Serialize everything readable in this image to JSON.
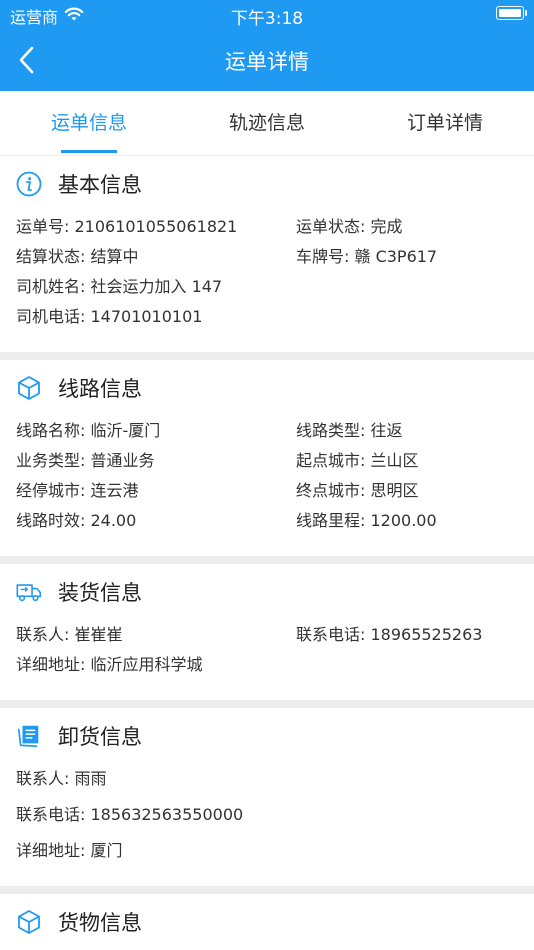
{
  "status_bar": {
    "carrier": "运营商",
    "time": "下午3:18"
  },
  "nav": {
    "title": "运单详情"
  },
  "tabs": [
    {
      "label": "运单信息",
      "active": true
    },
    {
      "label": "轨迹信息",
      "active": false
    },
    {
      "label": "订单详情",
      "active": false
    }
  ],
  "basic": {
    "title": "基本信息",
    "waybill_no": "运单号: 2106101055061821",
    "waybill_status": "运单状态: 完成",
    "settle_status": "结算状态: 结算中",
    "plate": "车牌号: 赣 C3P617",
    "driver_name": "司机姓名: 社会运力加入 147",
    "driver_phone": "司机电话: 14701010101"
  },
  "route": {
    "title": "线路信息",
    "name": "线路名称: 临沂-厦门",
    "type": "线路类型: 往返",
    "biz_type": "业务类型: 普通业务",
    "start_city": "起点城市: 兰山区",
    "via_city": "经停城市: 连云港",
    "end_city": "终点城市: 思明区",
    "timeliness": "线路时效: 24.00",
    "mileage": "线路里程: 1200.00"
  },
  "loading": {
    "title": "装货信息",
    "contact": "联系人: 崔崔崔",
    "phone": "联系电话: 18965525263",
    "address": "详细地址: 临沂应用科学城"
  },
  "unloading": {
    "title": "卸货信息",
    "contact": "联系人: 雨雨",
    "phone": "联系电话: 185632563550000",
    "address": "详细地址: 厦门"
  },
  "cargo": {
    "title": "货物信息"
  },
  "colors": {
    "accent": "#1e9af2",
    "divider": "#ececec"
  },
  "icons": [
    "wifi-icon",
    "battery-icon",
    "back-chevron-icon",
    "info-icon",
    "cube-icon",
    "truck-icon",
    "clipboard-icon"
  ]
}
